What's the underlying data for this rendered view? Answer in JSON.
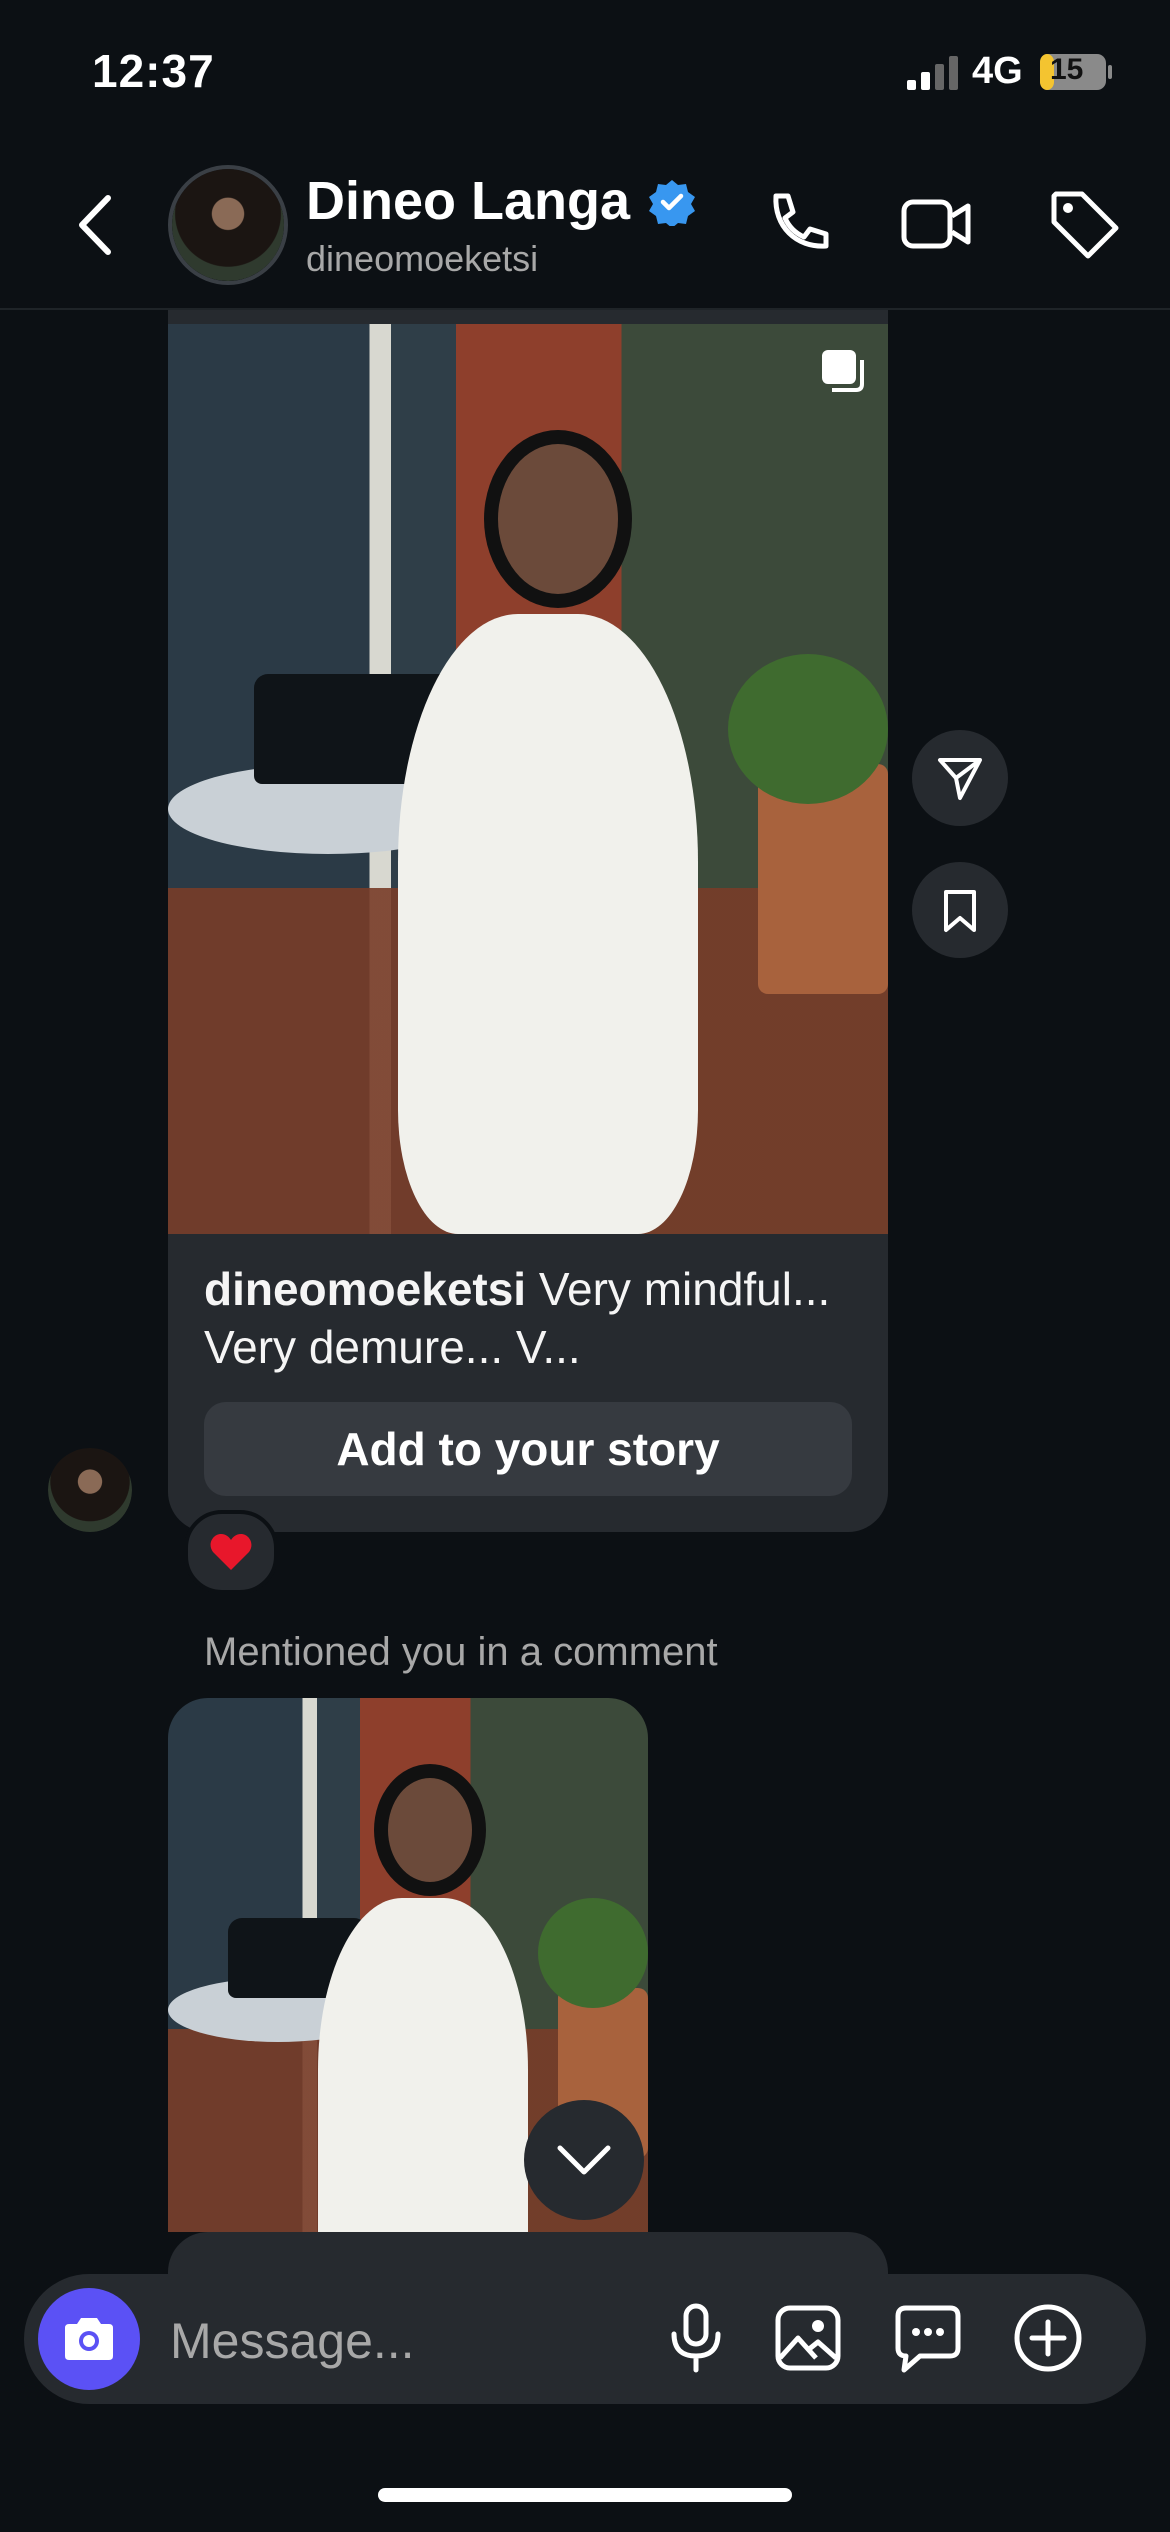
{
  "status_bar": {
    "time": "12:37",
    "network": "4G",
    "battery": "15"
  },
  "header": {
    "name": "Dineo Langa",
    "handle": "dineomoeketsi",
    "verified": true
  },
  "post": {
    "username": "dineomoeketsi",
    "caption": "Very mindful... Very demure... V...",
    "add_story_label": "Add to your story"
  },
  "reaction": {
    "emoji": "❤️"
  },
  "mention": {
    "label": "Mentioned you in a comment"
  },
  "composer": {
    "placeholder": "Message..."
  },
  "colors": {
    "background": "#0c1014",
    "bubble": "#262a2f",
    "camera": "#5b51f5",
    "verified": "#3897f0"
  },
  "icons": [
    "back-icon",
    "phone-icon",
    "video-icon",
    "tag-icon",
    "multi-photo-icon",
    "share-icon",
    "bookmark-icon",
    "chevron-down-icon",
    "camera-icon",
    "mic-icon",
    "gallery-icon",
    "sticker-icon",
    "plus-circle-icon"
  ]
}
